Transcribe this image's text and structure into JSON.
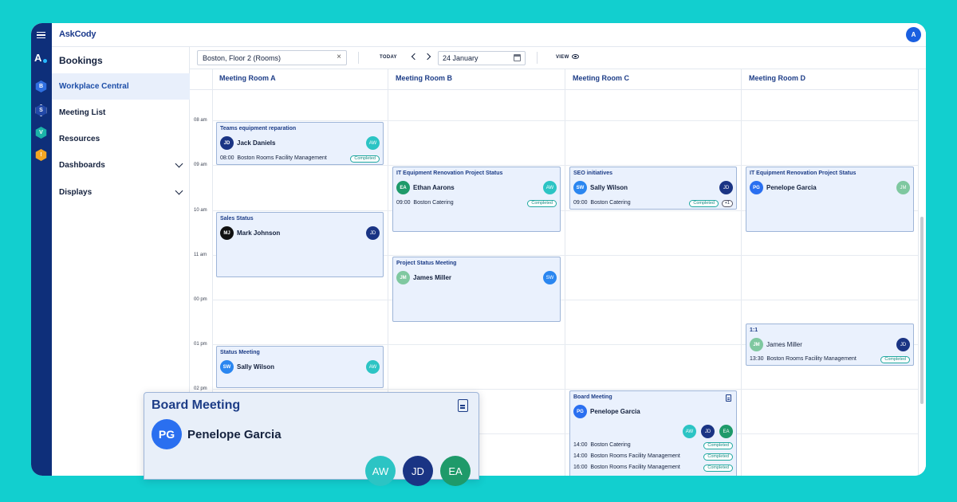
{
  "app": {
    "brand": "AskCody",
    "user_initial": "A"
  },
  "rail": {
    "logo": "A",
    "icons": [
      {
        "letter": "B",
        "color": "#2f6fe0"
      },
      {
        "letter": "S",
        "color": "#2249a8"
      },
      {
        "letter": "V",
        "color": "#1bb3a8"
      },
      {
        "letter": "!",
        "color": "#f5a623"
      }
    ]
  },
  "sidenav": {
    "title": "Bookings",
    "items": [
      {
        "label": "Workplace Central",
        "active": true
      },
      {
        "label": "Meeting List"
      },
      {
        "label": "Resources"
      },
      {
        "label": "Dashboards",
        "expandable": true
      },
      {
        "label": "Displays",
        "expandable": true
      }
    ]
  },
  "toolbar": {
    "location": "Boston, Floor 2 (Rooms)",
    "clear": "×",
    "today": "TODAY",
    "date": "24 January",
    "view": "VIEW"
  },
  "calendar": {
    "rooms": [
      "Meeting Room A",
      "Meeting Room B",
      "Meeting Room C",
      "Meeting Room D"
    ],
    "times": [
      "08 am",
      "09 am",
      "10 am",
      "11 am",
      "00 pm",
      "01 pm",
      "02 pm"
    ],
    "events": {
      "a1": {
        "title": "Teams equipment reparation",
        "person": "Jack Daniels",
        "initials": "JD",
        "other": "AW",
        "time": "08:00",
        "service": "Boston Rooms Facility Management",
        "status": "Completed"
      },
      "a2": {
        "title": "Sales Status",
        "person": "Mark Johnson",
        "initials": "MJ",
        "other": "JD"
      },
      "a3": {
        "title": "Status Meeting",
        "person": "Sally Wilson",
        "initials": "SW",
        "other": "AW"
      },
      "b1": {
        "title": "IT Equipment Renovation Project Status",
        "person": "Ethan Aarons",
        "initials": "EA",
        "other": "AW",
        "time": "09:00",
        "service": "Boston Catering",
        "status": "Completed"
      },
      "b2": {
        "title": "Project Status Meeting",
        "person": "James Miller",
        "initials": "JM",
        "other": "SW"
      },
      "c1": {
        "title": "SEO initiatives",
        "person": "Sally Wilson",
        "initials": "SW",
        "other": "JD",
        "time": "09:00",
        "service": "Boston Catering",
        "status": "Completed",
        "extra": "+1"
      },
      "c2": {
        "title": "Board Meeting",
        "person": "Penelope Garcia",
        "initials": "PG",
        "attendees": [
          "AW",
          "JD",
          "EA"
        ],
        "services": [
          {
            "time": "14:00",
            "service": "Boston Catering",
            "status": "Completed"
          },
          {
            "time": "14:00",
            "service": "Boston Rooms Facility Management",
            "status": "Completed"
          },
          {
            "time": "16:00",
            "service": "Boston Rooms Facility Management",
            "status": "Completed"
          }
        ]
      },
      "d1": {
        "title": "IT Equipment Renovation Project Status",
        "person": "Penelope Garcia",
        "initials": "PG",
        "other": "JM"
      },
      "d2": {
        "title": "1:1",
        "person": "James Miller",
        "initials": "JM",
        "other": "JD",
        "time": "13:30",
        "service": "Boston Rooms Facility Management",
        "status": "Completed"
      }
    }
  },
  "popover": {
    "title": "Board Meeting",
    "person": "Penelope Garcia",
    "initials": "PG",
    "attendees": [
      "AW",
      "JD",
      "EA"
    ]
  },
  "colors": {
    "JD": "#1a3484",
    "AW": "#2cc4c4",
    "EA": "#1e9a6a",
    "SW": "#2a86f0",
    "JM": "#7fc8a0",
    "MJ": "#111111",
    "PG": "#2a6ff0"
  }
}
